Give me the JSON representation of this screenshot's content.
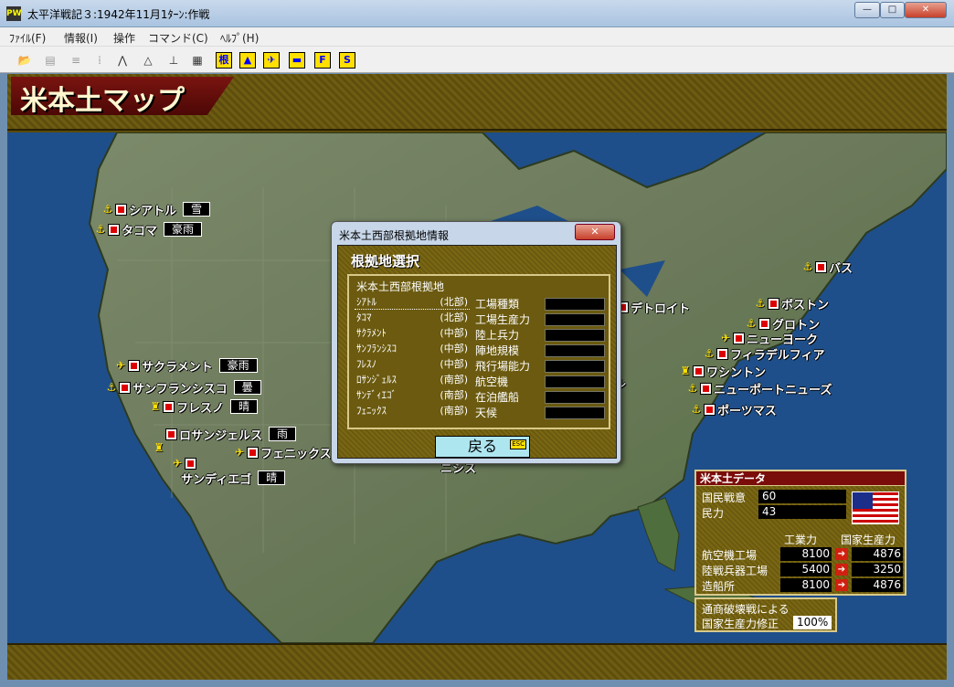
{
  "window": {
    "title": "太平洋戦記３:1942年11月1ﾀｰﾝ:作戦",
    "icon_text": "PW",
    "min": "—",
    "max": "□",
    "close": "✕"
  },
  "menu": [
    "ﾌｧｲﾙ(F)",
    "情報(I)",
    "操作",
    "コマンド(C)",
    "ﾍﾙﾌﾟ(H)"
  ],
  "toolbar": {
    "icons": [
      "open-icon",
      "save-icon",
      "list-icon",
      "stats-icon",
      "compass-icon",
      "divider-icon",
      "ruler-icon",
      "document-icon",
      "base-icon",
      "terrain-icon",
      "aircraft-icon",
      "ship-icon",
      "f-icon",
      "s-icon"
    ],
    "base_label": "根",
    "f_label": "F",
    "s_label": "S"
  },
  "page_title": "米本土マップ",
  "cities": {
    "seattle": {
      "name": "シアトル",
      "weather": "雪"
    },
    "tacoma": {
      "name": "タコマ",
      "weather": "豪雨"
    },
    "sacramento": {
      "name": "サクラメント",
      "weather": "豪雨"
    },
    "sanfrancisco": {
      "name": "サンフランシスコ",
      "weather": "曇"
    },
    "fresno": {
      "name": "フレスノ",
      "weather": "晴"
    },
    "losangeles": {
      "name": "ロサンジェルス",
      "weather": "雨"
    },
    "phoenix": {
      "name": "フェニックス",
      "weather": ""
    },
    "sandiego": {
      "name": "サンディエゴ",
      "weather": "晴"
    },
    "detroit": {
      "name": "デトロイト"
    },
    "bath": {
      "name": "バス"
    },
    "boston": {
      "name": "ボストン"
    },
    "groton": {
      "name": "グロトン"
    },
    "newyork": {
      "name": "ニューヨーク"
    },
    "philadelphia": {
      "name": "フィラデルフィア"
    },
    "washington": {
      "name": "ワシントン"
    },
    "newportnews": {
      "name": "ニューポートニューズ"
    },
    "portsmouth": {
      "name": "ポーツマス"
    },
    "partial_mid": "ル",
    "partial_south": "ニシス"
  },
  "dialog": {
    "title": "米本土西部根拠地情報",
    "close": "✕",
    "heading": "根拠地選択",
    "subheading": "米本土西部根拠地",
    "bases": [
      {
        "name": "ｼｱﾄﾙ",
        "region": "(北部)"
      },
      {
        "name": "ﾀｺﾏ",
        "region": "(北部)"
      },
      {
        "name": "ｻｸﾗﾒﾝﾄ",
        "region": "(中部)"
      },
      {
        "name": "ｻﾝﾌﾗﾝｼｽｺ",
        "region": "(中部)"
      },
      {
        "name": "ﾌﾚｽﾉ",
        "region": "(中部)"
      },
      {
        "name": "ﾛｻﾝｼﾞｪﾙｽ",
        "region": "(南部)"
      },
      {
        "name": "ｻﾝﾃﾞｨｴｺﾞ",
        "region": "(南部)"
      },
      {
        "name": "ﾌｪﾆｯｸｽ",
        "region": "(南部)"
      }
    ],
    "info_labels": [
      "工場種類",
      "工場生産力",
      "陸上兵力",
      "陣地規模",
      "飛行場能力",
      "航空機",
      "在泊艦船",
      "天候"
    ],
    "back_label": "戻る",
    "esc_label": "ESC"
  },
  "data_panel": {
    "title": "米本土データ",
    "morale_label": "国民戦意",
    "morale_value": "60",
    "power_label": "民力",
    "power_value": "43",
    "col_industry": "工業力",
    "col_national": "国家生産力",
    "rows": [
      {
        "label": "航空機工場",
        "industry": "8100",
        "national": "4876"
      },
      {
        "label": "陸戦兵器工場",
        "industry": "5400",
        "national": "3250"
      },
      {
        "label": "造船所",
        "industry": "8100",
        "national": "4876"
      }
    ],
    "modifier_line1": "通商破壊戦による",
    "modifier_line2": "国家生産力修正",
    "modifier_value": "100%"
  }
}
